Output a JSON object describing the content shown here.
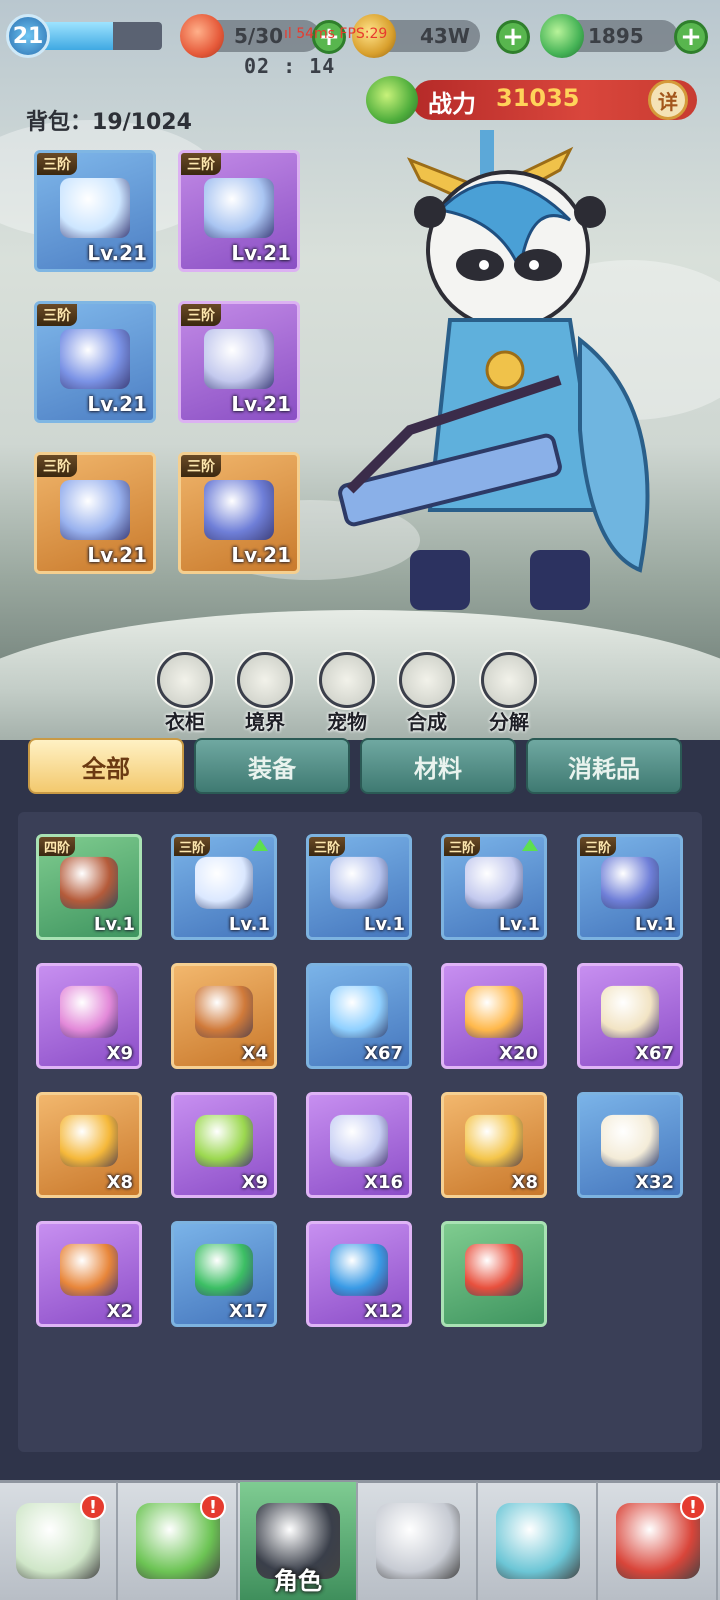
{
  "player": {
    "level": "21",
    "exp_fraction": 0.62
  },
  "resources": {
    "stamina": "5/30",
    "gold": "43W",
    "jade": "1895"
  },
  "debug_overlay": "ıl 54ms  FPS:29",
  "timer": "02 : 14",
  "bag": {
    "label": "背包：",
    "count": "19/1024"
  },
  "combat_power": {
    "label": "战力",
    "value": "31035",
    "detail_label": "详"
  },
  "equipped": [
    {
      "tier": "三阶",
      "level": "Lv.21",
      "rarity": "blue",
      "icon": "crossbow-icon"
    },
    {
      "tier": "三阶",
      "level": "Lv.21",
      "rarity": "purple",
      "icon": "helmet-icon"
    },
    {
      "tier": "三阶",
      "level": "Lv.21",
      "rarity": "blue",
      "icon": "armor-icon"
    },
    {
      "tier": "三阶",
      "level": "Lv.21",
      "rarity": "purple",
      "icon": "ring-icon"
    },
    {
      "tier": "三阶",
      "level": "Lv.21",
      "rarity": "orange",
      "icon": "gauntlet-icon"
    },
    {
      "tier": "三阶",
      "level": "Lv.21",
      "rarity": "orange",
      "icon": "boots-icon"
    }
  ],
  "functions": [
    {
      "label": "衣柜",
      "icon": "wardrobe-icon"
    },
    {
      "label": "境界",
      "icon": "realm-icon"
    },
    {
      "label": "宠物",
      "icon": "pet-icon"
    },
    {
      "label": "合成",
      "icon": "synthesis-icon"
    },
    {
      "label": "分解",
      "icon": "decompose-icon"
    }
  ],
  "tabs": [
    {
      "label": "全部",
      "active": true
    },
    {
      "label": "装备",
      "active": false
    },
    {
      "label": "材料",
      "active": false
    },
    {
      "label": "消耗品",
      "active": false
    }
  ],
  "inventory": [
    {
      "tier": "四阶",
      "level": "Lv.1",
      "rarity": "green",
      "icon": "staff-icon"
    },
    {
      "tier": "三阶",
      "level": "Lv.1",
      "rarity": "blue",
      "icon": "sword-icon",
      "upgrade": true
    },
    {
      "tier": "三阶",
      "level": "Lv.1",
      "rarity": "blue",
      "icon": "necklace-icon"
    },
    {
      "tier": "三阶",
      "level": "Lv.1",
      "rarity": "blue",
      "icon": "ring-icon",
      "upgrade": true
    },
    {
      "tier": "三阶",
      "level": "Lv.1",
      "rarity": "blue",
      "icon": "boots-icon"
    },
    {
      "qty": "X9",
      "rarity": "purple",
      "icon": "gift-bag-icon"
    },
    {
      "qty": "X4",
      "rarity": "orange",
      "icon": "treasure-chest-icon"
    },
    {
      "qty": "X67",
      "rarity": "blue",
      "icon": "blue-lotus-icon"
    },
    {
      "qty": "X20",
      "rarity": "purple",
      "icon": "golden-lotus-icon"
    },
    {
      "qty": "X67",
      "rarity": "purple",
      "icon": "scroll-icon"
    },
    {
      "qty": "X8",
      "rarity": "orange",
      "icon": "gold-ore-icon"
    },
    {
      "qty": "X9",
      "rarity": "purple",
      "icon": "jade-pendant-icon"
    },
    {
      "qty": "X16",
      "rarity": "purple",
      "icon": "silver-key-icon"
    },
    {
      "qty": "X8",
      "rarity": "orange",
      "icon": "golden-key-icon"
    },
    {
      "qty": "X32",
      "rarity": "blue",
      "icon": "skill-scroll-icon"
    },
    {
      "qty": "X2",
      "rarity": "purple",
      "icon": "talisman-icon"
    },
    {
      "qty": "X17",
      "rarity": "blue",
      "icon": "green-orb-box-icon"
    },
    {
      "qty": "X12",
      "rarity": "purple",
      "icon": "blue-orb-box-icon"
    },
    {
      "qty": "",
      "rarity": "green",
      "icon": "red-crystal-icon"
    }
  ],
  "nav": [
    {
      "label": "",
      "icon": "map-icon",
      "badge": "!"
    },
    {
      "label": "",
      "icon": "frog-coin-icon",
      "badge": "!"
    },
    {
      "label": "角色",
      "icon": "panda-hat-icon",
      "active": true
    },
    {
      "label": "",
      "icon": "crossed-swords-icon"
    },
    {
      "label": "",
      "icon": "gourd-icon"
    },
    {
      "label": "",
      "icon": "paw-shield-icon",
      "badge": "!"
    }
  ],
  "colors": {
    "accent_gold": "#ffd35a",
    "power_red": "#d9463c",
    "tab_active": "#f3c96e",
    "tab_idle": "#4f8a82"
  }
}
